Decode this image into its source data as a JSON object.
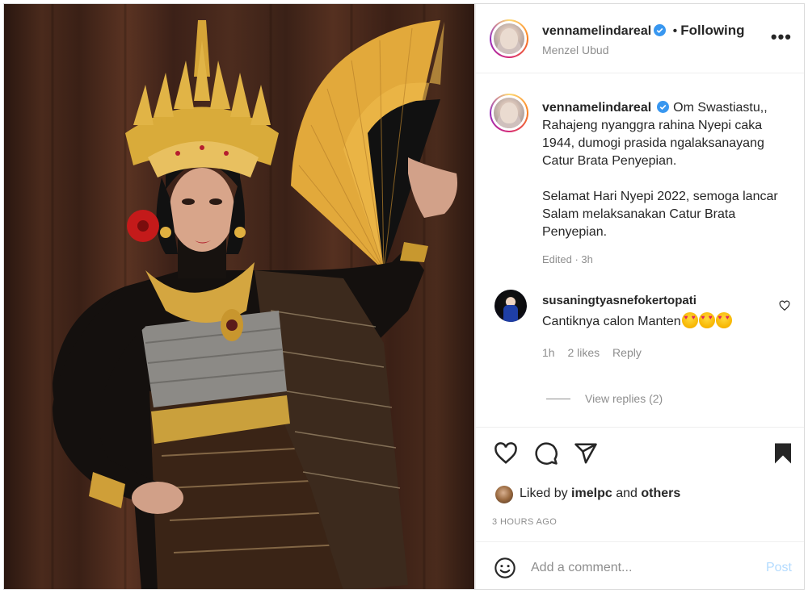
{
  "post": {
    "username": "vennamelindareal",
    "follow_status": "Following",
    "location": "Menzel Ubud",
    "more_label": "•••",
    "separator": "•"
  },
  "caption": {
    "username": "vennamelindareal",
    "paragraph_1": "Om Swastiastu,, Rahajeng nyanggra rahina Nyepi caka 1944, dumogi prasida ngalaksanayang Catur Brata Penyepian.",
    "paragraph_2": "Selamat Hari Nyepi 2022, semoga lancar Salam melaksanakan Catur Brata Penyepian.",
    "edited": "Edited · 3h"
  },
  "comment": {
    "username": "susaningtyasnefokertopati",
    "text": "Cantiknya calon Manten",
    "emoji_name": "heart-eyes-emoji",
    "emoji_count": 3,
    "time": "1h",
    "likes": "2 likes",
    "reply_label": "Reply",
    "view_replies": "View replies (2)"
  },
  "likes": {
    "prefix": "Liked by",
    "user": "imelpc",
    "conjunction": "and",
    "others": "others"
  },
  "timestamp": "3 HOURS AGO",
  "add_comment": {
    "placeholder": "Add a comment...",
    "post_label": "Post"
  },
  "colors": {
    "verified": "#3897f0",
    "post_button_disabled": "#b3dbff",
    "secondary_text": "#8e8e8e",
    "primary_text": "#262626",
    "border": "#dbdbdb"
  },
  "icons": {
    "like": "heart-icon",
    "comment": "comment-icon",
    "share": "send-icon",
    "save": "bookmark-filled-icon",
    "emoji": "smiley-icon",
    "more": "more-options-icon"
  }
}
